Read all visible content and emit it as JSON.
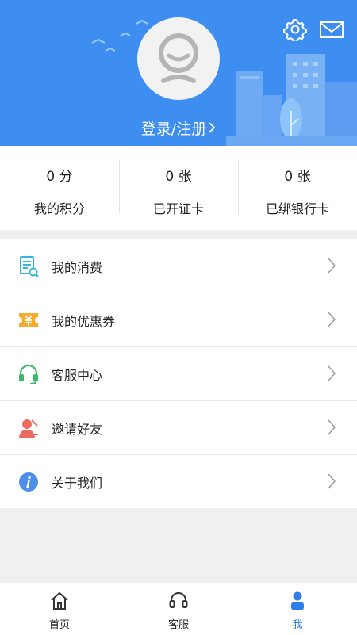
{
  "header": {
    "login_label": "登录/注册",
    "bg_color": "#3d8ef0"
  },
  "stats": [
    {
      "value": "0 分",
      "label": "我的积分"
    },
    {
      "value": "0 张",
      "label": "已开证卡"
    },
    {
      "value": "0 张",
      "label": "已绑银行卡"
    }
  ],
  "menu": [
    {
      "label": "我的消费",
      "icon": "receipt-icon"
    },
    {
      "label": "我的优惠券",
      "icon": "coupon-icon"
    },
    {
      "label": "客服中心",
      "icon": "headset-icon"
    },
    {
      "label": "邀请好友",
      "icon": "invite-user-icon"
    },
    {
      "label": "关于我们",
      "icon": "info-icon"
    }
  ],
  "tabs": [
    {
      "label": "首页",
      "icon": "home-icon",
      "active": false
    },
    {
      "label": "客服",
      "icon": "headphones-icon",
      "active": false
    },
    {
      "label": "我",
      "icon": "user-icon",
      "active": true
    }
  ],
  "colors": {
    "accent": "#2f7fe8"
  }
}
